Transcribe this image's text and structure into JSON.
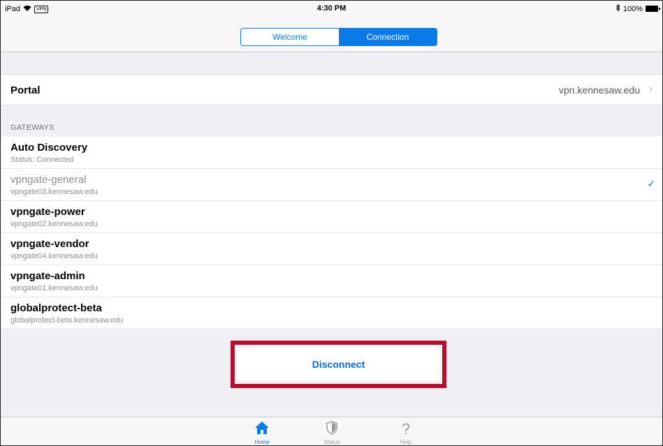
{
  "status_bar": {
    "device": "iPad",
    "wifi_icon": "wifi-icon",
    "vpn_badge": "VPN",
    "time": "4:30 PM",
    "bluetooth_icon": "bluetooth-icon",
    "battery": "100%"
  },
  "segmented": {
    "tabs": [
      {
        "label": "Welcome",
        "active": false
      },
      {
        "label": "Connection",
        "active": true
      }
    ]
  },
  "portal": {
    "label": "Portal",
    "value": "vpn.kennesaw.edu",
    "chevron": "›"
  },
  "gateways": {
    "header": "GATEWAYS",
    "items": [
      {
        "name": "Auto Discovery",
        "sub": "Status: Connected",
        "selected": false
      },
      {
        "name": "vpngate-general",
        "sub": "vpngate03.kennesaw.edu",
        "selected": true
      },
      {
        "name": "vpngate-power",
        "sub": "vpngate02.kennesaw.edu",
        "selected": false
      },
      {
        "name": "vpngate-vendor",
        "sub": "vpngate04.kennesaw.edu",
        "selected": false
      },
      {
        "name": "vpngate-admin",
        "sub": "vpngate01.kennesaw.edu",
        "selected": false
      },
      {
        "name": "globalprotect-beta",
        "sub": "globalprotect-beta.kennesaw.edu",
        "selected": false
      }
    ],
    "check": "✓"
  },
  "actions": {
    "disconnect_label": "Disconnect"
  },
  "tab_bar": {
    "tabs": [
      {
        "label": "Home",
        "icon": "home-icon",
        "glyph": "⌂",
        "active": true
      },
      {
        "label": "Status",
        "icon": "shield-icon",
        "glyph": "⛉",
        "active": false
      },
      {
        "label": "Help",
        "icon": "help-icon",
        "glyph": "?",
        "active": false
      }
    ]
  },
  "colors": {
    "accent": "#0a7ae6",
    "highlight": "#b4102d",
    "background": "#efeff4"
  }
}
